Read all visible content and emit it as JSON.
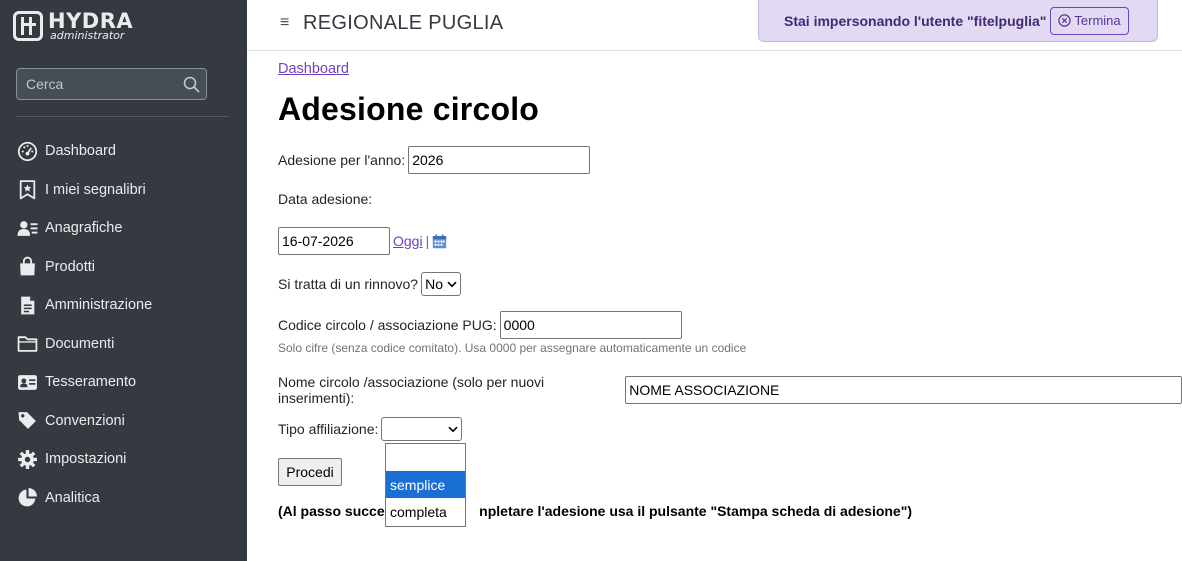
{
  "brand": {
    "title": "HYDRA",
    "subtitle": "administrator"
  },
  "sidebar": {
    "search_placeholder": "Cerca",
    "items": [
      {
        "label": "Dashboard",
        "icon": "dashboard-gauge-icon"
      },
      {
        "label": "I miei segnalibri",
        "icon": "bookmark-icon"
      },
      {
        "label": "Anagrafiche",
        "icon": "users-list-icon"
      },
      {
        "label": "Prodotti",
        "icon": "shopping-bag-icon"
      },
      {
        "label": "Amministrazione",
        "icon": "file-invoice-icon"
      },
      {
        "label": "Documenti",
        "icon": "folder-icon"
      },
      {
        "label": "Tesseramento",
        "icon": "id-card-icon"
      },
      {
        "label": "Convenzioni",
        "icon": "tags-icon"
      },
      {
        "label": "Impostazioni",
        "icon": "gear-icon"
      },
      {
        "label": "Analitica",
        "icon": "pie-chart-icon"
      }
    ]
  },
  "header": {
    "title": "REGIONALE PUGLIA",
    "impersonate_text": "Stai impersonando l'utente \"fitelpuglia\"",
    "terminate_label": "Termina"
  },
  "breadcrumb": "Dashboard",
  "page_title": "Adesione circolo",
  "form": {
    "year_label": "Adesione per l'anno:",
    "year_value": "2026",
    "date_label": "Data adesione:",
    "date_value": "16-07-2026",
    "today_link": "Oggi",
    "separator": "|",
    "renewal_label": "Si tratta di un rinnovo?",
    "renewal_value": "No",
    "code_label": "Codice circolo / associazione PUG:",
    "code_value": "0000",
    "code_help": "Solo cifre (senza codice comitato). Usa 0000 per assegnare automaticamente un codice",
    "name_label": "Nome circolo /associazione (solo per nuovi inserimenti):",
    "name_value": "NOME ASSOCIAZIONE",
    "type_label": "Tipo affiliazione:",
    "type_value": "",
    "type_options": [
      "",
      "semplice",
      "completa"
    ],
    "type_highlighted": "semplice",
    "submit_label": "Procedi",
    "note_before": "(Al passo success",
    "note_after": "npletare l'adesione usa il pulsante \"Stampa scheda di adesione\")"
  },
  "colors": {
    "sidebar_bg": "#343a40",
    "accent_purple": "#6f42c1",
    "impersonate_bg": "#e2d9f3",
    "selection_blue": "#1a6fd4"
  }
}
